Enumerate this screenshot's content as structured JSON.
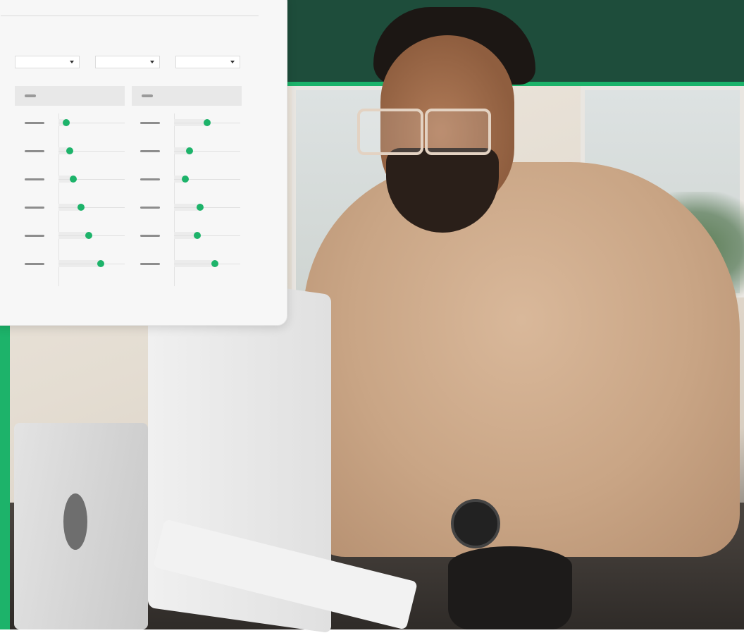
{
  "colors": {
    "brand_dark_green": "#1e4d3b",
    "brand_accent_green": "#1db36a",
    "card_background": "#f7f7f7"
  },
  "photo": {
    "subject": "man-at-computer-photo"
  },
  "card": {
    "filters": [
      {
        "icon": "chevron-down-icon"
      },
      {
        "icon": "chevron-down-icon"
      },
      {
        "icon": "chevron-down-icon"
      }
    ],
    "columns": [
      {
        "rows": [
          0.12,
          0.17,
          0.22,
          0.34,
          0.46,
          0.64
        ]
      },
      {
        "rows": [
          0.5,
          0.23,
          0.17,
          0.39,
          0.35,
          0.62
        ]
      }
    ]
  }
}
